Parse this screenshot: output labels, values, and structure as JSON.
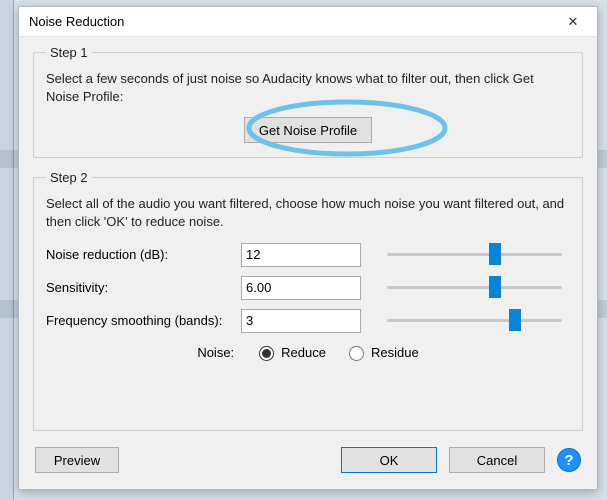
{
  "dialog": {
    "title": "Noise Reduction",
    "close_icon": "✕"
  },
  "step1": {
    "legend": "Step 1",
    "desc": "Select a few seconds of just noise so Audacity knows what to filter out, then click Get Noise Profile:",
    "get_profile_label": "Get Noise Profile"
  },
  "step2": {
    "legend": "Step 2",
    "desc": "Select all of the audio you want filtered, choose how much noise you want filtered out, and then click 'OK' to reduce noise.",
    "noise_reduction_label": "Noise reduction (dB):",
    "noise_reduction_value": "12",
    "sensitivity_label": "Sensitivity:",
    "sensitivity_value": "6.00",
    "freq_smoothing_label": "Frequency smoothing (bands):",
    "freq_smoothing_value": "3",
    "noise_label": "Noise:",
    "reduce_label": "Reduce",
    "residue_label": "Residue",
    "selected_mode": "reduce"
  },
  "footer": {
    "preview_label": "Preview",
    "ok_label": "OK",
    "cancel_label": "Cancel",
    "help_label": "?"
  },
  "annotation": {
    "color": "#6cc2ea"
  }
}
